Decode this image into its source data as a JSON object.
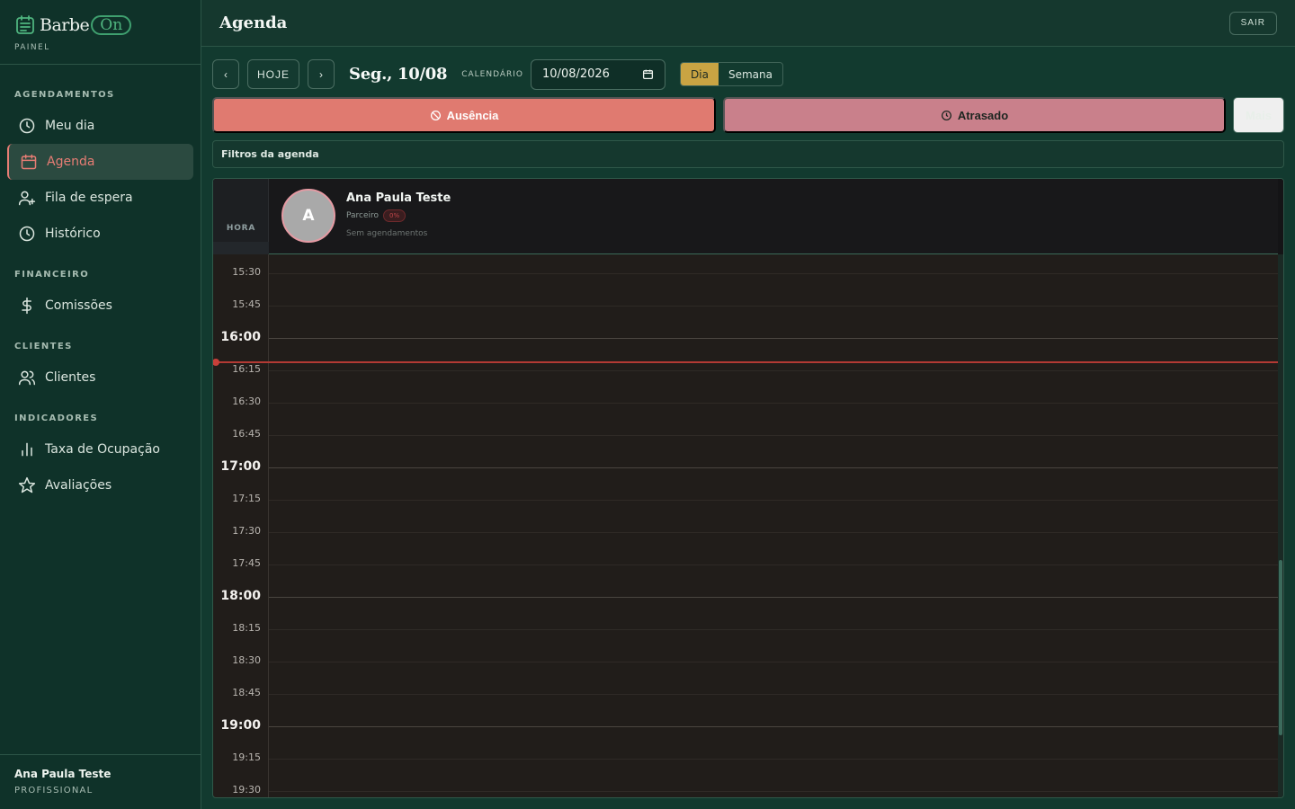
{
  "brand": {
    "name": "Barbe",
    "pill": "On",
    "subtitle": "PAINEL"
  },
  "sidebar": {
    "sections": [
      {
        "title": "AGENDAMENTOS",
        "items": [
          {
            "label": "Meu dia",
            "icon": "clock-icon"
          },
          {
            "label": "Agenda",
            "icon": "calendar-icon",
            "active": true
          },
          {
            "label": "Fila de espera",
            "icon": "user-plus-icon"
          },
          {
            "label": "Histórico",
            "icon": "history-icon"
          }
        ]
      },
      {
        "title": "FINANCEIRO",
        "items": [
          {
            "label": "Comissões",
            "icon": "dollar-icon"
          }
        ]
      },
      {
        "title": "CLIENTES",
        "items": [
          {
            "label": "Clientes",
            "icon": "users-icon"
          }
        ]
      },
      {
        "title": "INDICADORES",
        "items": [
          {
            "label": "Taxa de Ocupação",
            "icon": "bar-chart-icon"
          },
          {
            "label": "Avaliações",
            "icon": "star-icon"
          }
        ]
      }
    ],
    "user": {
      "name": "Ana Paula Teste",
      "role": "PROFISSIONAL"
    }
  },
  "header": {
    "title": "Agenda",
    "logout_label": "SAIR"
  },
  "toolbar": {
    "prev_label": "‹",
    "today_label": "HOJE",
    "next_label": "›",
    "date_title": "Seg., 10/08",
    "calendar_label": "CALENDÁRIO",
    "date_value": "10/08/2026",
    "view_options": [
      "Dia",
      "Semana"
    ],
    "selected_view": "Dia"
  },
  "actions": {
    "absence_label": "Ausência",
    "late_label": "Atrasado",
    "more_label": "Mais"
  },
  "filters": {
    "label": "Filtros da agenda"
  },
  "agenda": {
    "hour_column_label": "HORA",
    "professional": {
      "initial": "A",
      "name": "Ana Paula Teste",
      "role": "Parceiro",
      "badge": "0%",
      "status": "Sem agendamentos"
    },
    "time_slots": [
      "15:30",
      "15:45",
      "16:00",
      "16:15",
      "16:30",
      "16:45",
      "17:00",
      "17:15",
      "17:30",
      "17:45",
      "18:00",
      "18:15",
      "18:30",
      "18:45",
      "19:00",
      "19:15",
      "19:30"
    ],
    "current_time": "16:10"
  },
  "colors": {
    "accent": "#e77d74",
    "absence": "#e07a70",
    "late": "#c9808b",
    "view_selected": "#c9a443",
    "now_line": "#b33a34"
  }
}
